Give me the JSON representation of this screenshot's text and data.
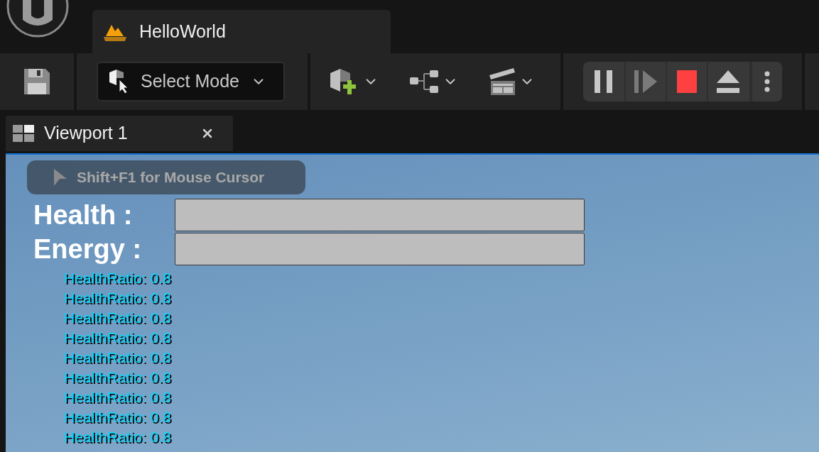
{
  "document_tab": {
    "title": "HelloWorld",
    "selected": true
  },
  "toolbar": {
    "mode_button": "Select Mode"
  },
  "playback": [
    {
      "kind": "pause",
      "disabled": false
    },
    {
      "kind": "step",
      "disabled": true
    },
    {
      "kind": "stop",
      "disabled": false
    },
    {
      "kind": "eject",
      "disabled": false
    },
    {
      "kind": "more",
      "disabled": false
    }
  ],
  "viewport_tab": {
    "title": "Viewport 1",
    "selected": true
  },
  "hud": {
    "tooltip": "Shift+F1 for Mouse Cursor",
    "stats": [
      {
        "label": "Health :"
      },
      {
        "label": "Energy :"
      }
    ],
    "debug_messages": [
      "HealthRatio: 0.8",
      "HealthRatio: 0.8",
      "HealthRatio: 0.8",
      "HealthRatio: 0.8",
      "HealthRatio: 0.8",
      "HealthRatio: 0.8",
      "HealthRatio: 0.8",
      "HealthRatio: 0.8",
      "HealthRatio: 0.8"
    ]
  }
}
